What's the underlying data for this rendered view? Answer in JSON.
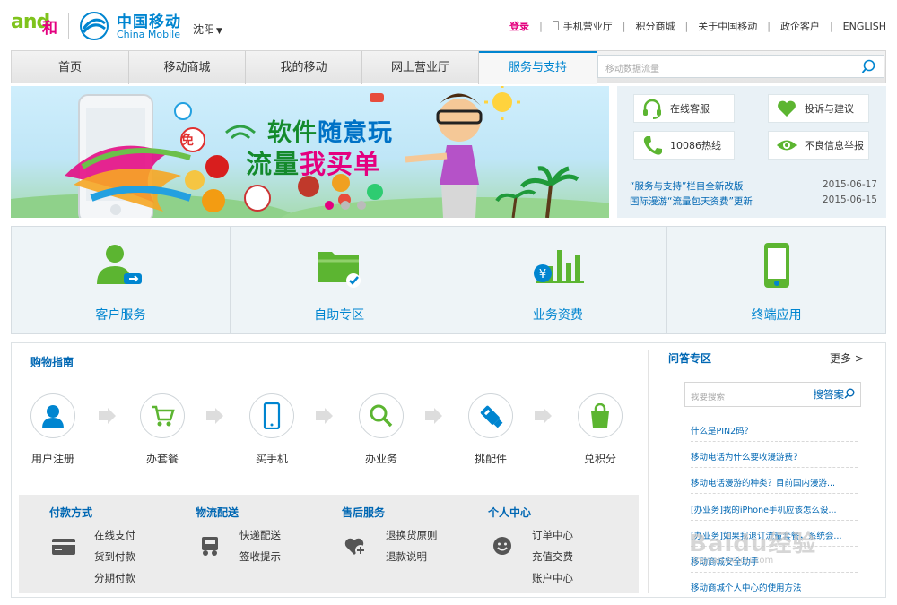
{
  "brand": {
    "and_logo": "and",
    "he_logo": "和",
    "cm_cn": "中国移动",
    "cm_en": "China Mobile"
  },
  "city": "沈阳",
  "toplinks": {
    "login": "登录",
    "mobile_hall": "手机营业厅",
    "points_mall": "积分商城",
    "about": "关于中国移动",
    "gov": "政企客户",
    "english": "ENGLISH"
  },
  "nav": {
    "items": [
      "首页",
      "移动商城",
      "我的移动",
      "网上营业厅",
      "服务与支持"
    ],
    "search_placeholder": "移动数据流量"
  },
  "banner": {
    "line1a": "软件",
    "line1b": "随意玩",
    "line2a": "流量",
    "line2b": "我买单",
    "free_badge": "免"
  },
  "service": {
    "buttons": [
      "在线客服",
      "投诉与建议",
      "10086热线",
      "不良信息举报"
    ],
    "news": [
      {
        "title": "“服务与支持”栏目全新改版",
        "date": "2015-06-17"
      },
      {
        "title": "国际漫游“流量包天资费”更新",
        "date": "2015-06-15"
      }
    ]
  },
  "categories": [
    "客户服务",
    "自助专区",
    "业务资费",
    "终端应用"
  ],
  "guide": {
    "title": "购物指南",
    "steps": [
      "用户注册",
      "办套餐",
      "买手机",
      "办业务",
      "挑配件",
      "兑积分"
    ]
  },
  "pay": {
    "columns": [
      {
        "title": "付款方式",
        "links": [
          "在线支付",
          "货到付款",
          "分期付款"
        ]
      },
      {
        "title": "物流配送",
        "links": [
          "快递配送",
          "签收提示"
        ]
      },
      {
        "title": "售后服务",
        "links": [
          "退换货原则",
          "退款说明"
        ]
      },
      {
        "title": "个人中心",
        "links": [
          "订单中心",
          "充值交费",
          "账户中心"
        ]
      }
    ]
  },
  "qa": {
    "title": "问答专区",
    "more": "更多 >",
    "search_placeholder": "我要搜索",
    "search_button": "搜答案",
    "items": [
      "什么是PIN2码？",
      "移动电话为什么要收漫游费？",
      "移动电话漫游的种类？目前国内漫游...",
      "[办业务]我的iPhone手机应该怎么设...",
      "[办业务]如果我退订流量套餐，系统会...",
      "移动商城安全助手",
      "移动商城个人中心的使用方法"
    ]
  },
  "watermark": {
    "main": "Baidu经验",
    "sub": "jingyan.baidu.com"
  },
  "colors": {
    "accent_blue": "#0085d0",
    "brand_pink": "#e4007f",
    "brand_green": "#7fc31c",
    "icon_green": "#5cb531"
  }
}
